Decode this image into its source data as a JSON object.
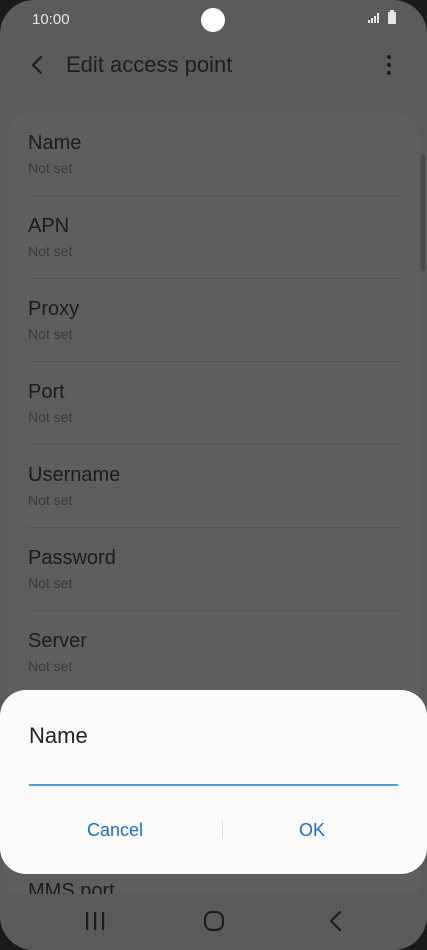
{
  "status_bar": {
    "time": "10:00",
    "icons": [
      "signal-icon",
      "battery-icon"
    ]
  },
  "app_bar": {
    "title": "Edit access point",
    "back_icon": "back-icon",
    "menu_icon": "more-vertical-icon"
  },
  "fields": [
    {
      "label": "Name",
      "value": "Not set"
    },
    {
      "label": "APN",
      "value": "Not set"
    },
    {
      "label": "Proxy",
      "value": "Not set"
    },
    {
      "label": "Port",
      "value": "Not set"
    },
    {
      "label": "Username",
      "value": "Not set"
    },
    {
      "label": "Password",
      "value": "Not set"
    },
    {
      "label": "Server",
      "value": "Not set"
    }
  ],
  "peek_field_label": "MMS port",
  "dialog": {
    "title": "Name",
    "input_value": "",
    "cancel_label": "Cancel",
    "ok_label": "OK"
  },
  "nav_bar": {
    "icons": [
      "recents-icon",
      "home-icon",
      "back-icon"
    ]
  },
  "colors": {
    "accent": "#1a6fc8",
    "input_underline": "#4a9fe0",
    "dim_overlay": "#5b5b5b",
    "dialog_bg": "#fbfbfb"
  }
}
